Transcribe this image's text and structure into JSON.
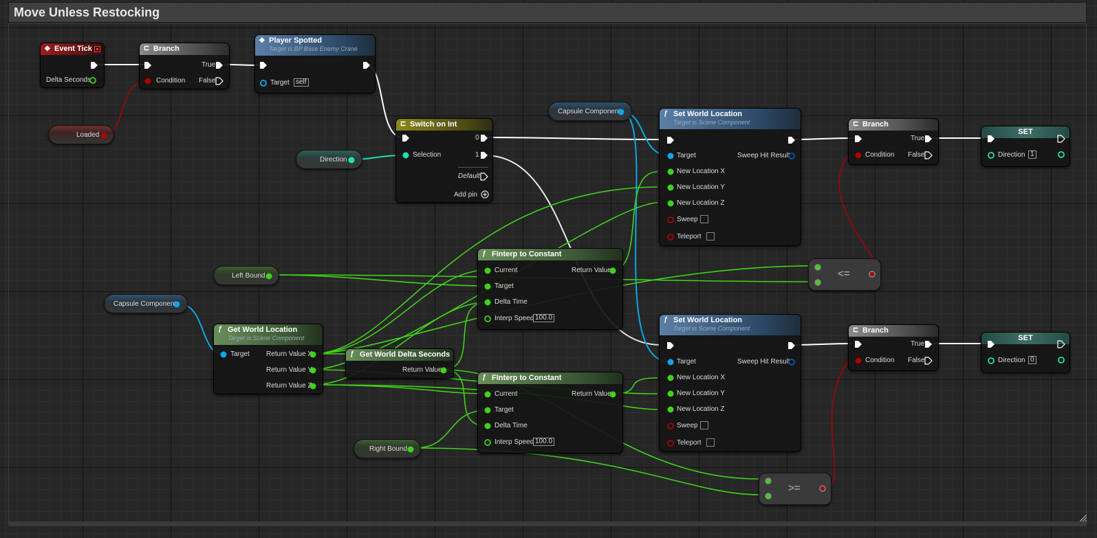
{
  "graph": {
    "title": "Move Unless Restocking"
  },
  "nodes": {
    "event_tick": {
      "title": "Event Tick",
      "output": "Delta Seconds"
    },
    "branch_top": {
      "title": "Branch",
      "condition": "Condition",
      "true": "True",
      "false": "False"
    },
    "player_spotted": {
      "title": "Player Spotted",
      "subtitle": "Target is BP Base Enemy Crane",
      "target": "Target",
      "target_value": "self"
    },
    "switch_int": {
      "title": "Switch on Int",
      "selection": "Selection",
      "out0": "0",
      "out1": "1",
      "default": "Default",
      "add_pin": "Add pin"
    },
    "set_loc_1": {
      "title": "Set World Location",
      "subtitle": "Target is Scene Component",
      "target": "Target",
      "sweep_hit": "Sweep Hit Result",
      "x": "New Location X",
      "y": "New Location Y",
      "z": "New Location Z",
      "sweep": "Sweep",
      "teleport": "Teleport"
    },
    "set_loc_2": {
      "title": "Set World Location",
      "subtitle": "Target is Scene Component",
      "target": "Target",
      "sweep_hit": "Sweep Hit Result",
      "x": "New Location X",
      "y": "New Location Y",
      "z": "New Location Z",
      "sweep": "Sweep",
      "teleport": "Teleport"
    },
    "branch_r1": {
      "title": "Branch",
      "condition": "Condition",
      "true": "True",
      "false": "False"
    },
    "branch_r2": {
      "title": "Branch",
      "condition": "Condition",
      "true": "True",
      "false": "False"
    },
    "set_1": {
      "title": "SET",
      "label": "Direction",
      "value": "1"
    },
    "set_2": {
      "title": "SET",
      "label": "Direction",
      "value": "0"
    },
    "finterp_1": {
      "title": "FInterp to Constant",
      "current": "Current",
      "target": "Target",
      "delta": "Delta Time",
      "speed": "Interp Speed",
      "speed_value": "100.0",
      "ret": "Return Value"
    },
    "finterp_2": {
      "title": "FInterp to Constant",
      "current": "Current",
      "target": "Target",
      "delta": "Delta Time",
      "speed": "Interp Speed",
      "speed_value": "100.0",
      "ret": "Return Value"
    },
    "get_world_loc": {
      "title": "Get World Location",
      "subtitle": "Target is Scene Component",
      "target": "Target",
      "x": "Return Value X",
      "y": "Return Value Y",
      "z": "Return Value Z"
    },
    "get_delta": {
      "title": "Get World Delta Seconds",
      "ret": "Return Value"
    },
    "op_le": {
      "symbol": "<="
    },
    "op_ge": {
      "symbol": ">="
    }
  },
  "variables": {
    "loaded": "Loaded",
    "direction": "Direction",
    "capsule_top": "Capsule Component",
    "capsule_left": "Capsule Component",
    "left_bound": "Left Bound",
    "right_bound": "Right Bound"
  },
  "colors": {
    "exec": "#ffffff",
    "boolean": "#8c0a0a",
    "float": "#3fd21a",
    "integer": "#1fe0b0",
    "object": "#0da6e6"
  }
}
